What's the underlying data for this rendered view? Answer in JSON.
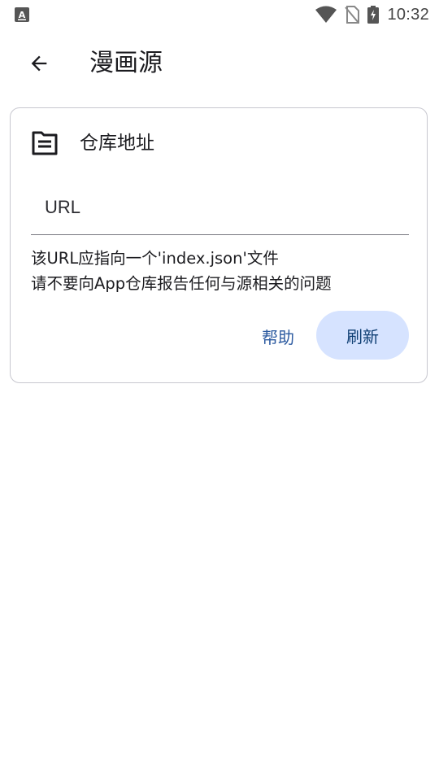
{
  "status_bar": {
    "time": "10:32",
    "icons": [
      "keyboard-app-icon",
      "wifi-icon",
      "no-sim-icon",
      "battery-charging-icon"
    ]
  },
  "app_bar": {
    "back_icon": "arrow-back-icon",
    "title": "漫画源"
  },
  "card": {
    "header_icon": "source-folder-icon",
    "title": "仓库地址",
    "url_field": {
      "placeholder": "URL",
      "value": ""
    },
    "hints": [
      "该URL应指向一个'index.json'文件",
      "请不要向App仓库报告任何与源相关的问题"
    ],
    "help_label": "帮助",
    "refresh_label": "刷新"
  },
  "colors": {
    "refresh_button_bg": "#d6e3ff",
    "refresh_button_text": "#0e3e73",
    "help_text": "#2c5aa0",
    "card_border": "#c7c7cf"
  }
}
